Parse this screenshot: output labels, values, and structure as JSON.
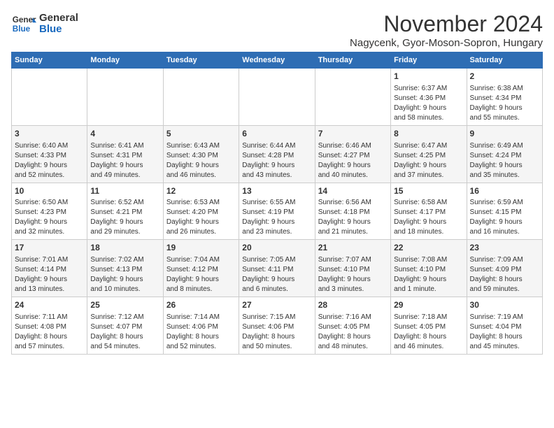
{
  "header": {
    "logo_line1": "General",
    "logo_line2": "Blue",
    "month": "November 2024",
    "location": "Nagycenk, Gyor-Moson-Sopron, Hungary"
  },
  "days_of_week": [
    "Sunday",
    "Monday",
    "Tuesday",
    "Wednesday",
    "Thursday",
    "Friday",
    "Saturday"
  ],
  "weeks": [
    [
      {
        "day": "",
        "data": ""
      },
      {
        "day": "",
        "data": ""
      },
      {
        "day": "",
        "data": ""
      },
      {
        "day": "",
        "data": ""
      },
      {
        "day": "",
        "data": ""
      },
      {
        "day": "1",
        "data": "Sunrise: 6:37 AM\nSunset: 4:36 PM\nDaylight: 9 hours\nand 58 minutes."
      },
      {
        "day": "2",
        "data": "Sunrise: 6:38 AM\nSunset: 4:34 PM\nDaylight: 9 hours\nand 55 minutes."
      }
    ],
    [
      {
        "day": "3",
        "data": "Sunrise: 6:40 AM\nSunset: 4:33 PM\nDaylight: 9 hours\nand 52 minutes."
      },
      {
        "day": "4",
        "data": "Sunrise: 6:41 AM\nSunset: 4:31 PM\nDaylight: 9 hours\nand 49 minutes."
      },
      {
        "day": "5",
        "data": "Sunrise: 6:43 AM\nSunset: 4:30 PM\nDaylight: 9 hours\nand 46 minutes."
      },
      {
        "day": "6",
        "data": "Sunrise: 6:44 AM\nSunset: 4:28 PM\nDaylight: 9 hours\nand 43 minutes."
      },
      {
        "day": "7",
        "data": "Sunrise: 6:46 AM\nSunset: 4:27 PM\nDaylight: 9 hours\nand 40 minutes."
      },
      {
        "day": "8",
        "data": "Sunrise: 6:47 AM\nSunset: 4:25 PM\nDaylight: 9 hours\nand 37 minutes."
      },
      {
        "day": "9",
        "data": "Sunrise: 6:49 AM\nSunset: 4:24 PM\nDaylight: 9 hours\nand 35 minutes."
      }
    ],
    [
      {
        "day": "10",
        "data": "Sunrise: 6:50 AM\nSunset: 4:23 PM\nDaylight: 9 hours\nand 32 minutes."
      },
      {
        "day": "11",
        "data": "Sunrise: 6:52 AM\nSunset: 4:21 PM\nDaylight: 9 hours\nand 29 minutes."
      },
      {
        "day": "12",
        "data": "Sunrise: 6:53 AM\nSunset: 4:20 PM\nDaylight: 9 hours\nand 26 minutes."
      },
      {
        "day": "13",
        "data": "Sunrise: 6:55 AM\nSunset: 4:19 PM\nDaylight: 9 hours\nand 23 minutes."
      },
      {
        "day": "14",
        "data": "Sunrise: 6:56 AM\nSunset: 4:18 PM\nDaylight: 9 hours\nand 21 minutes."
      },
      {
        "day": "15",
        "data": "Sunrise: 6:58 AM\nSunset: 4:17 PM\nDaylight: 9 hours\nand 18 minutes."
      },
      {
        "day": "16",
        "data": "Sunrise: 6:59 AM\nSunset: 4:15 PM\nDaylight: 9 hours\nand 16 minutes."
      }
    ],
    [
      {
        "day": "17",
        "data": "Sunrise: 7:01 AM\nSunset: 4:14 PM\nDaylight: 9 hours\nand 13 minutes."
      },
      {
        "day": "18",
        "data": "Sunrise: 7:02 AM\nSunset: 4:13 PM\nDaylight: 9 hours\nand 10 minutes."
      },
      {
        "day": "19",
        "data": "Sunrise: 7:04 AM\nSunset: 4:12 PM\nDaylight: 9 hours\nand 8 minutes."
      },
      {
        "day": "20",
        "data": "Sunrise: 7:05 AM\nSunset: 4:11 PM\nDaylight: 9 hours\nand 6 minutes."
      },
      {
        "day": "21",
        "data": "Sunrise: 7:07 AM\nSunset: 4:10 PM\nDaylight: 9 hours\nand 3 minutes."
      },
      {
        "day": "22",
        "data": "Sunrise: 7:08 AM\nSunset: 4:10 PM\nDaylight: 9 hours\nand 1 minute."
      },
      {
        "day": "23",
        "data": "Sunrise: 7:09 AM\nSunset: 4:09 PM\nDaylight: 8 hours\nand 59 minutes."
      }
    ],
    [
      {
        "day": "24",
        "data": "Sunrise: 7:11 AM\nSunset: 4:08 PM\nDaylight: 8 hours\nand 57 minutes."
      },
      {
        "day": "25",
        "data": "Sunrise: 7:12 AM\nSunset: 4:07 PM\nDaylight: 8 hours\nand 54 minutes."
      },
      {
        "day": "26",
        "data": "Sunrise: 7:14 AM\nSunset: 4:06 PM\nDaylight: 8 hours\nand 52 minutes."
      },
      {
        "day": "27",
        "data": "Sunrise: 7:15 AM\nSunset: 4:06 PM\nDaylight: 8 hours\nand 50 minutes."
      },
      {
        "day": "28",
        "data": "Sunrise: 7:16 AM\nSunset: 4:05 PM\nDaylight: 8 hours\nand 48 minutes."
      },
      {
        "day": "29",
        "data": "Sunrise: 7:18 AM\nSunset: 4:05 PM\nDaylight: 8 hours\nand 46 minutes."
      },
      {
        "day": "30",
        "data": "Sunrise: 7:19 AM\nSunset: 4:04 PM\nDaylight: 8 hours\nand 45 minutes."
      }
    ]
  ]
}
